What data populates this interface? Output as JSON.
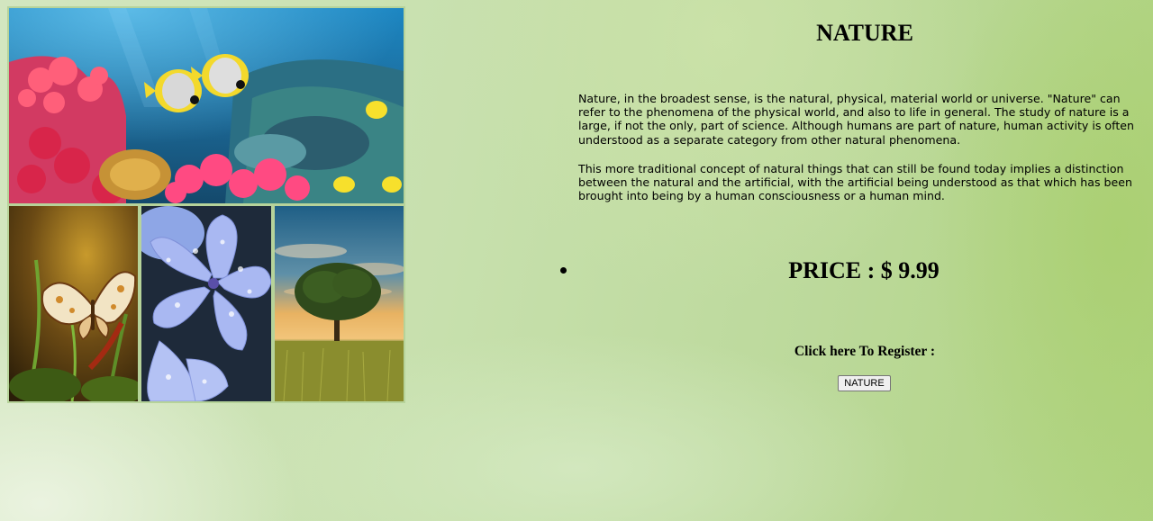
{
  "page": {
    "title": "NATURE",
    "paragraphs": [
      "Nature, in the broadest sense, is the natural, physical, material world or universe. \"Nature\" can refer to the phenomena of the physical world, and also to life in general. The study of nature is a large, if not the only, part of science. Although humans are part of nature, human activity is often understood as a separate category from other natural phenomena.",
      "This more traditional concept of natural things that can still be found today implies a distinction between the natural and the artificial, with the artificial being understood as that which has been brought into being by a human consciousness or a human mind."
    ],
    "price": "PRICE : $ 9.99",
    "register_label": "Click here To Register :",
    "register_button": "NATURE"
  },
  "collage": {
    "photos": [
      "coral-reef-photo",
      "butterfly-photo",
      "blue-flower-photo",
      "lone-tree-photo"
    ]
  },
  "colors": {
    "background": "#c3dda6",
    "text": "#000000",
    "button_bg": "#efefef"
  }
}
